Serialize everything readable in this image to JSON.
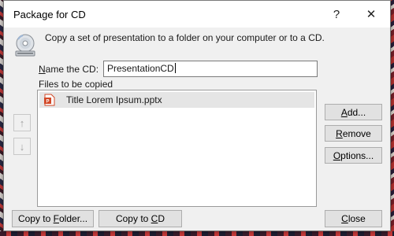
{
  "dialog": {
    "title": "Package for CD",
    "help_glyph": "?",
    "close_glyph": "✕",
    "description": "Copy a set of presentation to a folder on your computer or to a CD."
  },
  "name_field": {
    "label_prefix": "N",
    "label_rest": "ame the CD:",
    "value": "PresentationCD"
  },
  "files": {
    "label": "Files to be copied",
    "items": [
      {
        "name": "Title Lorem Ipsum.pptx",
        "selected": true
      }
    ]
  },
  "order_buttons": {
    "up_glyph": "↑",
    "down_glyph": "↓"
  },
  "side_buttons": {
    "add": {
      "pre": "",
      "key": "A",
      "post": "dd..."
    },
    "remove": {
      "pre": "",
      "key": "R",
      "post": "emove"
    },
    "options": {
      "pre": "",
      "key": "O",
      "post": "ptions..."
    }
  },
  "bottom_buttons": {
    "copy_folder": {
      "pre": "Copy to ",
      "key": "F",
      "post": "older..."
    },
    "copy_cd": {
      "pre": "Copy to ",
      "key": "C",
      "post": "D"
    },
    "close": {
      "pre": "",
      "key": "C",
      "post": "lose"
    }
  },
  "colors": {
    "dialog_bg": "#f0f0f0",
    "button_bg": "#e1e1e1",
    "selection_bg": "#e5e5e5",
    "pptx_orange": "#d24726"
  }
}
